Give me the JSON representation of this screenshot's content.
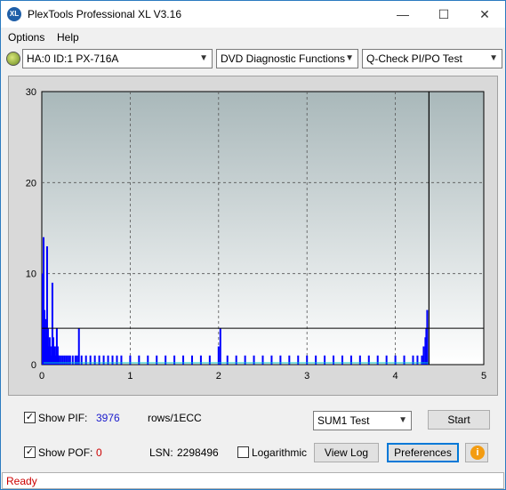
{
  "window": {
    "title": "PlexTools Professional XL V3.16",
    "app_icon_text": "XL",
    "minimize_glyph": "—",
    "maximize_glyph": "☐",
    "close_glyph": "✕"
  },
  "menu": {
    "options_label": "Options",
    "help_label": "Help"
  },
  "toolbar": {
    "drive_value": "HA:0 ID:1  PX-716A",
    "function_value": "DVD Diagnostic Functions",
    "test_value": "Q-Check PI/PO Test"
  },
  "chart_data": {
    "type": "bar",
    "title": "",
    "xlabel": "",
    "ylabel": "",
    "xlim": [
      0,
      5
    ],
    "ylim": [
      0,
      30
    ],
    "x_ticks": [
      "0",
      "1",
      "2",
      "3",
      "4",
      "5"
    ],
    "y_ticks": [
      "0",
      "10",
      "20",
      "30"
    ],
    "grid": true,
    "threshold_line": 4,
    "end_marker_x": 4.38,
    "series": [
      {
        "color": "#0000ff",
        "x": [
          0.01,
          0.02,
          0.03,
          0.04,
          0.05,
          0.06,
          0.07,
          0.08,
          0.09,
          0.1,
          0.11,
          0.12,
          0.13,
          0.14,
          0.15,
          0.16,
          0.17,
          0.18,
          0.19,
          0.2,
          0.22,
          0.24,
          0.26,
          0.28,
          0.3,
          0.32,
          0.35,
          0.38,
          0.4,
          0.42,
          0.45,
          0.5,
          0.55,
          0.6,
          0.65,
          0.7,
          0.75,
          0.8,
          0.85,
          0.9,
          1.0,
          1.1,
          1.2,
          1.3,
          1.4,
          1.5,
          1.6,
          1.7,
          1.8,
          1.9,
          2.0,
          2.02,
          2.1,
          2.2,
          2.3,
          2.4,
          2.5,
          2.6,
          2.7,
          2.8,
          2.9,
          3.0,
          3.1,
          3.2,
          3.3,
          3.4,
          3.5,
          3.6,
          3.7,
          3.8,
          3.9,
          4.0,
          4.1,
          4.2,
          4.25,
          4.3,
          4.32,
          4.34,
          4.35,
          4.36
        ],
        "values": [
          10,
          14,
          6,
          5,
          3,
          13,
          4,
          2,
          3,
          2,
          1,
          9,
          3,
          2,
          2,
          1,
          4,
          2,
          1,
          1,
          1,
          1,
          1,
          1,
          1,
          1,
          1,
          1,
          1,
          4,
          1,
          1,
          1,
          1,
          1,
          1,
          1,
          1,
          1,
          1,
          1,
          1,
          1,
          1,
          1,
          1,
          1,
          1,
          1,
          1,
          2,
          4,
          1,
          1,
          1,
          1,
          1,
          1,
          1,
          1,
          1,
          1,
          1,
          1,
          1,
          1,
          1,
          1,
          1,
          1,
          1,
          1,
          1,
          1,
          1,
          1,
          2,
          3,
          4,
          6
        ]
      }
    ]
  },
  "controls": {
    "show_pif_label": "Show PIF:",
    "pif_value": "3976",
    "pif_unit": "rows/1ECC",
    "show_pof_label": "Show POF:",
    "pof_value": "0",
    "lsn_label": "LSN:",
    "lsn_value": "2298496",
    "logarithmic_label": "Logarithmic",
    "sum_select_value": "SUM1 Test",
    "start_button": "Start",
    "view_log_button": "View Log",
    "preferences_button": "Preferences",
    "info_icon_glyph": "i",
    "check_glyph": "✓"
  },
  "status": {
    "text": "Ready"
  }
}
